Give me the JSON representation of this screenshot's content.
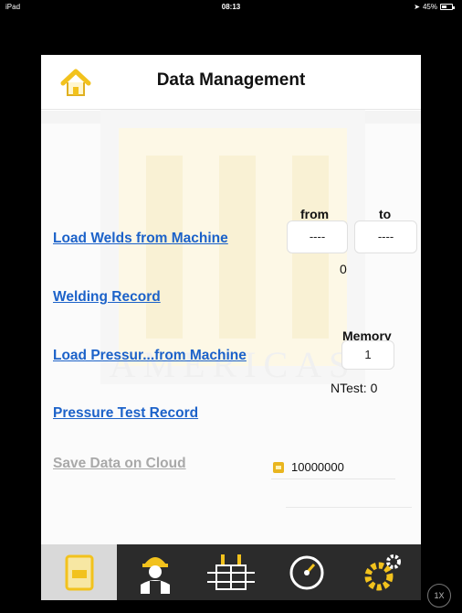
{
  "status_bar": {
    "device": "iPad",
    "time": "08:13",
    "battery": "45%"
  },
  "header": {
    "title": "Data Management"
  },
  "watermark": {
    "text": "AMERICAS"
  },
  "actions": {
    "load_welds": "Load Welds from Machine",
    "welding_record": "Welding Record",
    "load_pressure": "Load Pressur...from Machine",
    "pressure_record": "Pressure Test Record",
    "save_cloud": "Save Data on Cloud"
  },
  "range": {
    "from_label": "from",
    "to_label": "to",
    "from_value": "----",
    "to_value": "----",
    "count": "0"
  },
  "memory": {
    "label": "Memory",
    "value": "1",
    "ntest": "NTest: 0"
  },
  "cloud": {
    "id": "10000000"
  },
  "tabs": [
    {
      "name": "data-management",
      "active": true
    },
    {
      "name": "operator",
      "active": false
    },
    {
      "name": "welding",
      "active": false
    },
    {
      "name": "pressure-gauge",
      "active": false
    },
    {
      "name": "settings",
      "active": false
    }
  ],
  "zoom": {
    "label": "1X"
  },
  "colors": {
    "link": "#1c62c9",
    "disabled": "#a9a9a9",
    "accent": "#f2c21d",
    "tabbar": "#2b2b2b"
  }
}
